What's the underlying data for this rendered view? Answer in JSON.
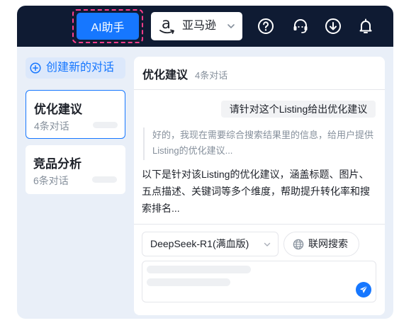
{
  "header": {
    "ai_button_label": "AI助手",
    "store": {
      "logo_glyph": "a",
      "name": "亚马逊"
    },
    "icons": {
      "help": "help-circle-icon",
      "support": "headset-icon",
      "download": "download-circle-icon",
      "notification": "bell-icon"
    }
  },
  "sidebar": {
    "new_chat_label": "创建新的对话",
    "new_chat_icon": "plus-circle-icon",
    "conversations": [
      {
        "title": "优化建议",
        "count": "4条对话",
        "active": true
      },
      {
        "title": "竞品分析",
        "count": "6条对话",
        "active": false
      }
    ]
  },
  "chat": {
    "title": "优化建议",
    "count": "4条对话",
    "user_message": "请针对这个Listing给出优化建议",
    "thinking": "好的，我现在需要综合搜索结果里的信息，给用户提供Listing的优化建议...",
    "answer": "以下是针对该Listing的优化建议，涵盖标题、图片、五点描述、关键词等多个维度，帮助提升转化率和搜索排名...",
    "model": "DeepSeek-R1(满血版)",
    "web_search_label": "联网搜索",
    "send_icon": "send-icon"
  },
  "colors": {
    "primary": "#1677ff",
    "topbar": "#0f1b33",
    "highlight_outline": "#ff3d8b",
    "panel_bg": "#e9eff8",
    "muted_text": "#86909c"
  }
}
